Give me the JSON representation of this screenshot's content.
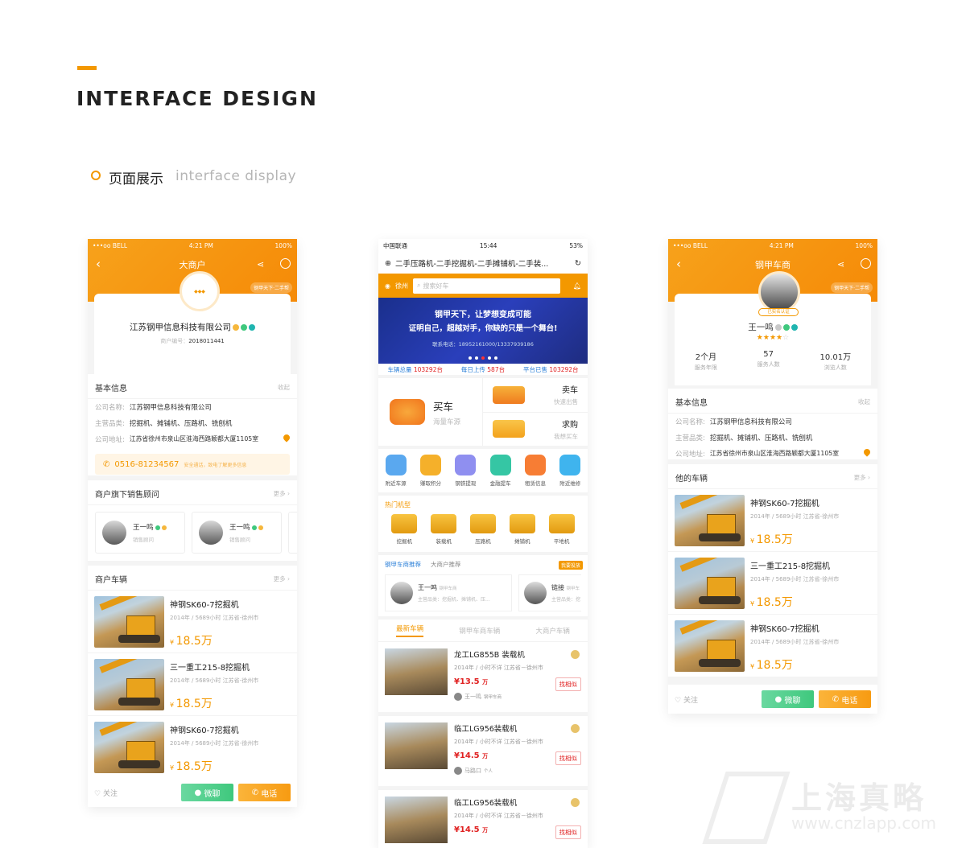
{
  "header": {
    "title": "INTERFACE DESIGN",
    "section_title": "页面展示",
    "section_sub": "interface display"
  },
  "colors": {
    "accent": "#f39800",
    "green": "#3fc87d",
    "red": "#e02020",
    "blue": "#2a7fd8"
  },
  "p1": {
    "status": {
      "carrier": "•••oo BELL",
      "time": "4:21 PM",
      "battery": "100%"
    },
    "nav_title": "大商户",
    "tag": "钢甲天下·二手帮",
    "company": "江苏钢甲信息科技有限公司",
    "id_label": "商户编号：",
    "id_value": "2018011441",
    "basic": {
      "title": "基本信息",
      "fold": "收起",
      "rows": [
        {
          "k": "公司名称:",
          "v": "江苏钢甲信息科技有限公司"
        },
        {
          "k": "主营品类:",
          "v": "挖掘机、摊铺机、压路机、铣刨机"
        },
        {
          "k": "公司地址:",
          "v": "江苏省徐州市泉山区淮海西路颖都大厦1105室"
        }
      ]
    },
    "phone": "0516-81234567",
    "phone_tip": "安全通话，致电了解更多信息",
    "advisors": {
      "title": "商户旗下销售顾问",
      "more": "更多",
      "items": [
        {
          "name": "王一鸣",
          "role": "销售顾问"
        },
        {
          "name": "王一鸣",
          "role": "销售顾问"
        }
      ]
    },
    "cars": {
      "title": "商户车辆",
      "more": "更多",
      "items": [
        {
          "name": "神钢SK60-7挖掘机",
          "meta": "2014年 / 5689小时   江苏省-徐州市",
          "price": "18.5万"
        },
        {
          "name": "三一重工215-8挖掘机",
          "meta": "2014年 / 5689小时   江苏省-徐州市",
          "price": "18.5万"
        },
        {
          "name": "神钢SK60-7挖掘机",
          "meta": "2014年 / 5689小时   江苏省-徐州市",
          "price": "18.5万"
        }
      ]
    },
    "bottom": {
      "fav": "关注",
      "wechat": "微聊",
      "call": "电话"
    }
  },
  "p2": {
    "status": {
      "carrier": "中国联通",
      "time": "15:44",
      "battery": "53%"
    },
    "url": "二手压路机-二手挖掘机-二手摊铺机-二手装...",
    "city": "徐州",
    "search_placeholder": "搜索好车",
    "banner": {
      "line1": "钢甲天下，让梦想变成可能",
      "line2": "证明自己，超越对手，你缺的只是一个舞台!",
      "line3": "联系电话：18952161000/13337939186"
    },
    "stats": [
      {
        "label": "车辆总量",
        "value": "103292台"
      },
      {
        "label": "每日上传",
        "value": "587台"
      },
      {
        "label": "平台已售",
        "value": "103292台"
      }
    ],
    "buy": {
      "title": "买车",
      "sub": "海量车源"
    },
    "sell": {
      "title": "卖车",
      "sub": "快速出售"
    },
    "want": {
      "title": "求购",
      "sub": "我想买车"
    },
    "services": [
      "附近车源",
      "赚取积分",
      "钢铁提现",
      "金融提车",
      "租赁信息",
      "附近维修"
    ],
    "service_colors": [
      "#5aa8ef",
      "#f5b02a",
      "#8f8ff0",
      "#35c6a4",
      "#f77d34",
      "#3fb4ee"
    ],
    "hot": {
      "title": "热门机型",
      "items": [
        "挖掘机",
        "装载机",
        "压路机",
        "摊铺机",
        "平地机"
      ]
    },
    "rec": {
      "tab1": "钢甲车商推荐",
      "tab2": "大商户推荐",
      "badge": "我要投放",
      "items": [
        {
          "name": "王一鸣",
          "tag": "钢甲车商",
          "desc": "主营品类：挖掘机、摊铺机、压..."
        },
        {
          "name": "链接",
          "tag": "钢甲车",
          "desc": "主营品类：挖"
        }
      ]
    },
    "tabs": [
      "最新车辆",
      "钢甲车商车辆",
      "大商户车辆"
    ],
    "listings": [
      {
        "name": "龙工LG855B 装载机",
        "meta": "2014年 / 小时不详 江苏省－徐州市",
        "price": "13.5",
        "unit": "万",
        "seller": "王一鸣",
        "seller_tag": "钢甲车商",
        "find": "找相似"
      },
      {
        "name": "临工LG956装载机",
        "meta": "2014年 / 小时不详 江苏省－徐州市",
        "price": "14.5",
        "unit": "万",
        "seller": "马路口",
        "seller_tag": "个人",
        "find": "找相似"
      },
      {
        "name": "临工LG956装载机",
        "meta": "2014年 / 小时不详 江苏省－徐州市",
        "price": "14.5",
        "unit": "万",
        "find": "找相似"
      }
    ]
  },
  "p3": {
    "status": {
      "carrier": "•••oo BELL",
      "time": "4:21 PM",
      "battery": "100%"
    },
    "nav_title": "钢甲车商",
    "tag": "钢甲天下·二手帮",
    "verified": "已实名认证",
    "name": "王一鸣",
    "stars": 4,
    "stats": [
      {
        "value": "2个月",
        "label": "服务年限"
      },
      {
        "value": "57",
        "label": "服务人数"
      },
      {
        "value": "10.01万",
        "label": "浏览人数"
      }
    ],
    "basic": {
      "title": "基本信息",
      "fold": "收起",
      "rows": [
        {
          "k": "公司名称:",
          "v": "江苏钢甲信息科技有限公司"
        },
        {
          "k": "主营品类:",
          "v": "挖掘机、摊铺机、压路机、铣刨机"
        },
        {
          "k": "公司地址:",
          "v": "江苏省徐州市泉山区淮海西路颖都大厦1105室"
        }
      ]
    },
    "cars": {
      "title": "他的车辆",
      "more": "更多",
      "items": [
        {
          "name": "神钢SK60-7挖掘机",
          "meta": "2014年 / 5689小时   江苏省-徐州市",
          "price": "18.5万"
        },
        {
          "name": "三一重工215-8挖掘机",
          "meta": "2014年 / 5689小时   江苏省-徐州市",
          "price": "18.5万"
        },
        {
          "name": "神钢SK60-7挖掘机",
          "meta": "2014年 / 5689小时   江苏省-徐州市",
          "price": "18.5万"
        }
      ]
    },
    "bottom": {
      "fav": "关注",
      "wechat": "微聊",
      "call": "电话"
    }
  },
  "watermark": {
    "cn": "上海真略",
    "en": "www.cnzlapp.com"
  }
}
